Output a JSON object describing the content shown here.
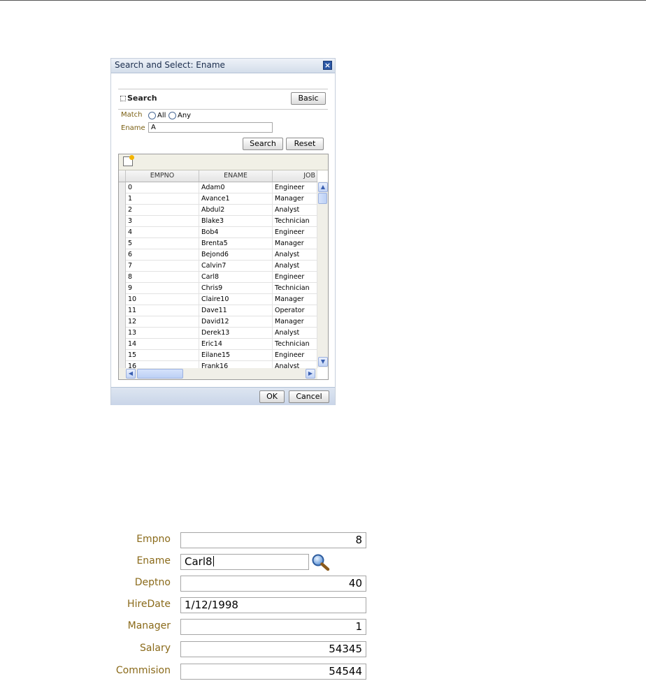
{
  "dialog": {
    "title": "Search and Select: Ename",
    "close_glyph": "×",
    "search_header": "Search",
    "basic_button": "Basic",
    "match_label": "Match",
    "match_all": "All",
    "match_any": "Any",
    "ename_label": "Ename",
    "ename_value": "A",
    "search_button": "Search",
    "reset_button": "Reset",
    "ok_button": "OK",
    "cancel_button": "Cancel",
    "table": {
      "columns": [
        "EMPNO",
        "ENAME",
        "JOB"
      ],
      "rows": [
        [
          "0",
          "Adam0",
          "Engineer"
        ],
        [
          "1",
          "Avance1",
          "Manager"
        ],
        [
          "2",
          "Abdul2",
          "Analyst"
        ],
        [
          "3",
          "Blake3",
          "Technician"
        ],
        [
          "4",
          "Bob4",
          "Engineer"
        ],
        [
          "5",
          "Brenta5",
          "Manager"
        ],
        [
          "6",
          "Bejond6",
          "Analyst"
        ],
        [
          "7",
          "Calvin7",
          "Analyst"
        ],
        [
          "8",
          "Carl8",
          "Engineer"
        ],
        [
          "9",
          "Chris9",
          "Technician"
        ],
        [
          "10",
          "Claire10",
          "Manager"
        ],
        [
          "11",
          "Dave11",
          "Operator"
        ],
        [
          "12",
          "David12",
          "Manager"
        ],
        [
          "13",
          "Derek13",
          "Analyst"
        ],
        [
          "14",
          "Eric14",
          "Technician"
        ],
        [
          "15",
          "Eilane15",
          "Engineer"
        ],
        [
          "16",
          "Frank16",
          "Analyst"
        ]
      ]
    }
  },
  "form": {
    "empno_label": "Empno",
    "empno_value": "8",
    "ename_label": "Ename",
    "ename_value": "Carl8",
    "deptno_label": "Deptno",
    "deptno_value": "40",
    "hiredate_label": "HireDate",
    "hiredate_value": "1/12/1998",
    "manager_label": "Manager",
    "manager_value": "1",
    "salary_label": "Salary",
    "salary_value": "54345",
    "commision_label": "Commision",
    "commision_value": "54544"
  },
  "colors": {
    "label": "#8a6a1a",
    "dialog_header": "#d3ddea",
    "close_button": "#2c58a6"
  },
  "icons": [
    "close-icon",
    "collapse-icon",
    "new-record-icon",
    "search-icon",
    "scroll-up-icon",
    "scroll-down-icon",
    "scroll-left-icon",
    "scroll-right-icon"
  ]
}
